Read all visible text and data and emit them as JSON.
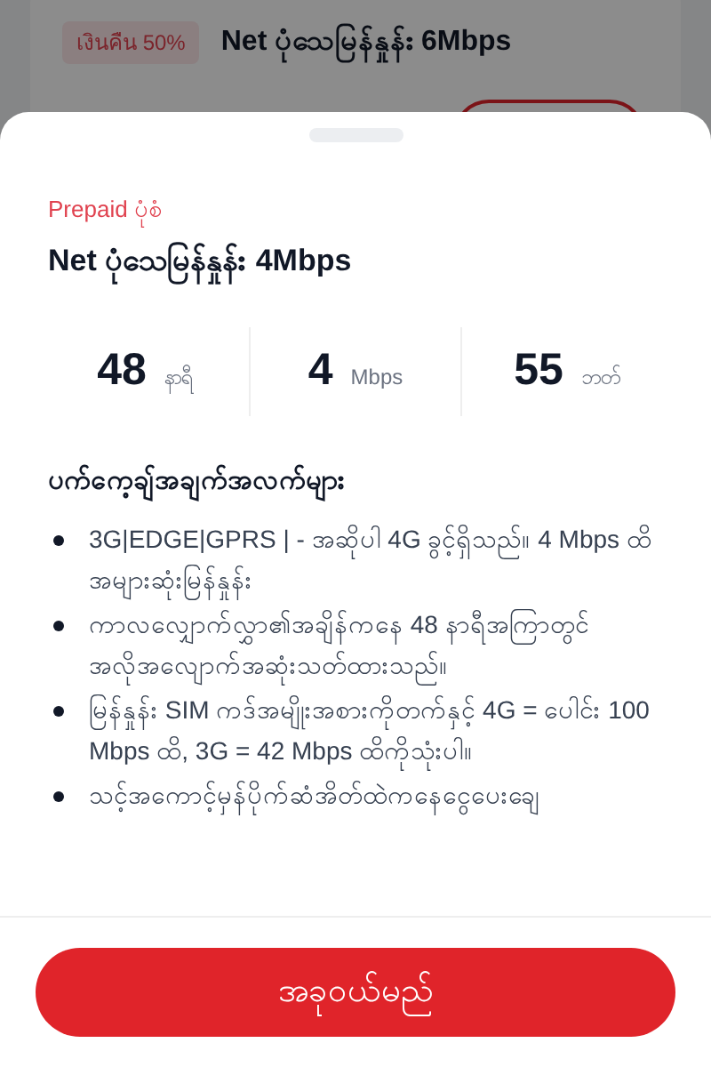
{
  "background_card": {
    "badge": "เงินคืน 50%",
    "title": "Net ပုံသေမြန်နှုန်း 6Mbps"
  },
  "sheet": {
    "category": "Prepaid ပုံစံ",
    "title": "Net ပုံသေမြန်နှုန်း 4Mbps",
    "stats": [
      {
        "value": "48",
        "unit": "နာရီ"
      },
      {
        "value": "4",
        "unit": "Mbps"
      },
      {
        "value": "55",
        "unit": "ဘတ်"
      }
    ],
    "details_heading": "ပက်ကေ့ချ်အချက်အလက်များ",
    "details": [
      "3G|EDGE|GPRS | - အဆိုပါ 4G ခွင့်ရှိသည်။ 4 Mbps ထိအများဆုံးမြန်နှုန်း",
      "ကာလလျှောက်လွှာ၏အချိန်ကနေ 48 နာရီအကြာတွင်အလိုအလျောက်အဆုံးသတ်ထားသည်။",
      "မြန်နှုန်း SIM ကဒ်အမျိုးအစားကိုတက်နှင့် 4G = ပေါင်း 100 Mbps ထိ, 3G = 42 Mbps ထိကိုသုံးပါ။",
      "သင့်အကောင့်မှန်ပိုက်ဆံအိတ်ထဲကနေငွေပေးချေ"
    ]
  },
  "buy_button": "အခုဝယ်မည်"
}
